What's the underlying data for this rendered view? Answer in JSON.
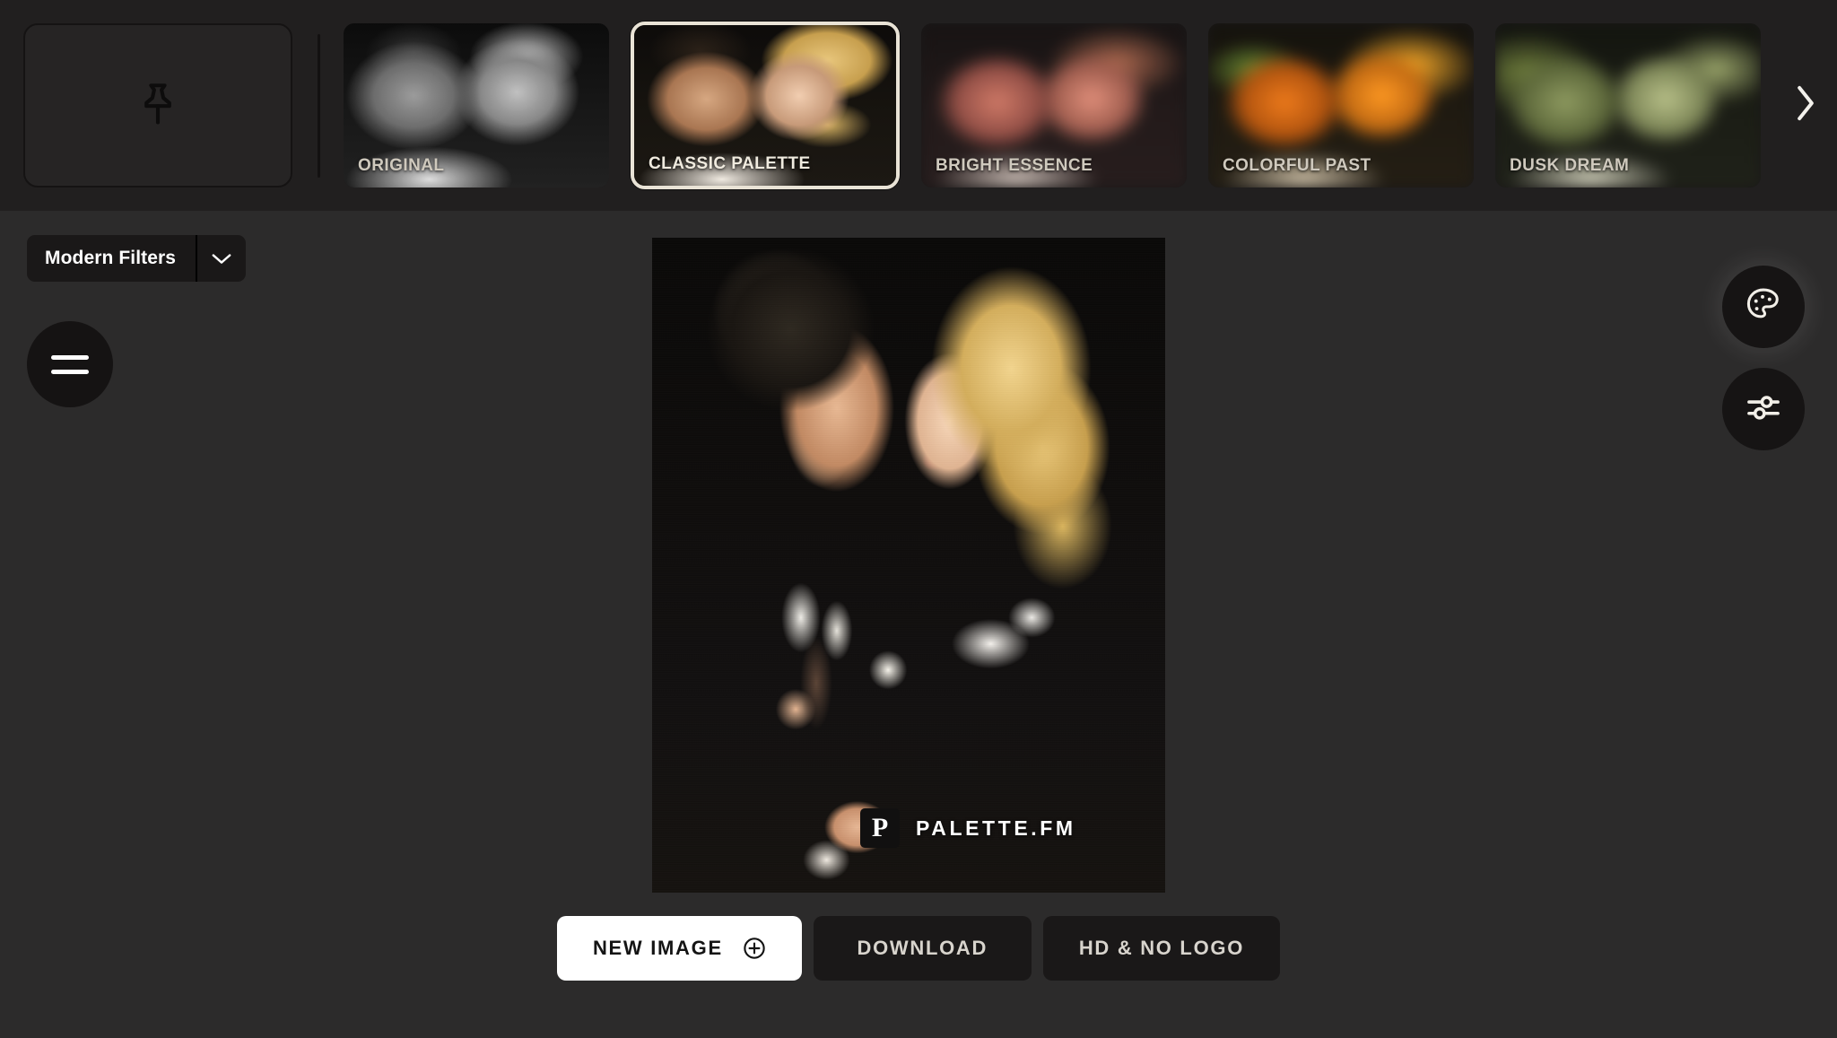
{
  "app": {
    "background": "#2c2b2b",
    "strip_background": "#211f1f",
    "accent": "#e9e3d6"
  },
  "filmstrip": {
    "pin_card": {
      "name": "pin-placeholder-card",
      "icon": "pushpin-icon"
    },
    "next_arrow_icon": "chevron-right-icon",
    "thumbnails": [
      {
        "label": "ORIGINAL",
        "art": "art-orig",
        "selected": false
      },
      {
        "label": "CLASSIC PALETTE",
        "art": "art-classic",
        "selected": true
      },
      {
        "label": "BRIGHT ESSENCE",
        "art": "art-bright",
        "selected": false
      },
      {
        "label": "COLORFUL PAST",
        "art": "art-colorful",
        "selected": false
      },
      {
        "label": "DUSK DREAM",
        "art": "art-dusk",
        "selected": false
      }
    ]
  },
  "left_controls": {
    "filter_group": {
      "selected_label": "Modern Filters",
      "caret_icon": "chevron-down-icon"
    },
    "menu_button": {
      "icon": "hamburger-menu-icon"
    }
  },
  "right_controls": {
    "palette_button": {
      "icon": "palette-icon",
      "active": true
    },
    "adjust_button": {
      "icon": "sliders-icon",
      "active": false
    }
  },
  "canvas": {
    "watermark": {
      "logo_letter": "P",
      "text": "PALETTE.FM"
    }
  },
  "actions": {
    "new_image": {
      "label": "NEW IMAGE",
      "icon": "plus-circle-icon"
    },
    "download": {
      "label": "DOWNLOAD"
    },
    "hd_no_logo": {
      "label": "HD & NO LOGO"
    }
  }
}
